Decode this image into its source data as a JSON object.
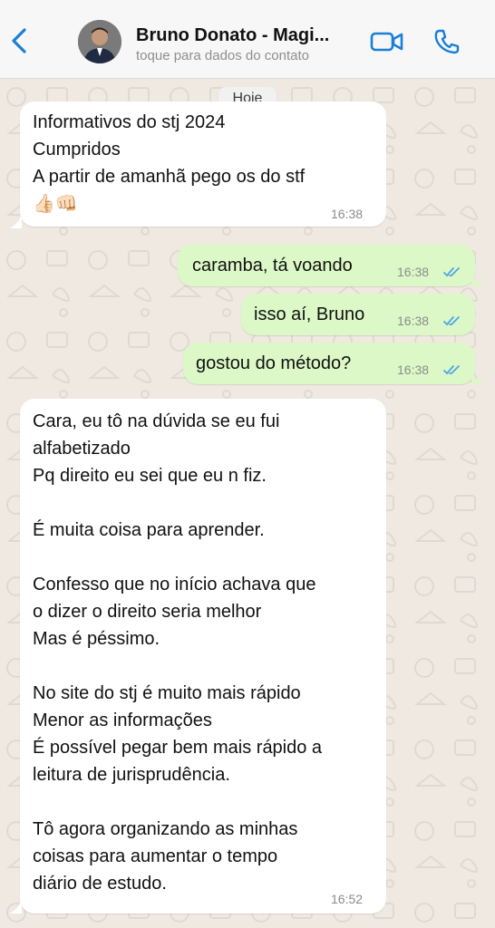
{
  "header": {
    "contact_name": "Bruno Donato - Magi...",
    "contact_subtitle": "toque para dados do contato"
  },
  "chat": {
    "date_label": "Hoje",
    "messages": [
      {
        "direction": "in",
        "text": "Informativos do stj 2024\nCumpridos\nA partir de amanhã pego os do stf\n👍🏻👊🏻",
        "time": "16:38"
      },
      {
        "direction": "out",
        "text": "caramba, tá voando",
        "time": "16:38",
        "status": "read"
      },
      {
        "direction": "out",
        "text": "isso aí, Bruno",
        "time": "16:38",
        "status": "read"
      },
      {
        "direction": "out",
        "text": "gostou do método?",
        "time": "16:38",
        "status": "read"
      },
      {
        "direction": "in",
        "text": "Cara, eu tô na dúvida se eu fui\nalfabetizado\nPq direito eu sei que eu n fiz.\n\nÉ muita coisa para aprender.\n\nConfesso que no início achava que\no dizer o direito seria melhor\nMas é péssimo.\n\nNo site do stj é muito mais rápido\nMenor as informações\nÉ possível pegar bem mais rápido a\nleitura de jurisprudência.\n\nTô agora organizando as minhas\ncoisas para aumentar o tempo\ndiário de estudo.",
        "time": "16:52"
      }
    ]
  },
  "colors": {
    "accent": "#1a7fd6",
    "incoming_bubble": "#ffffff",
    "outgoing_bubble": "#dcf8c6",
    "read_ticks": "#4fa6e6",
    "chat_background": "#efe9e1"
  },
  "icons": [
    "back-chevron-icon",
    "video-call-icon",
    "phone-call-icon",
    "double-check-icon"
  ]
}
